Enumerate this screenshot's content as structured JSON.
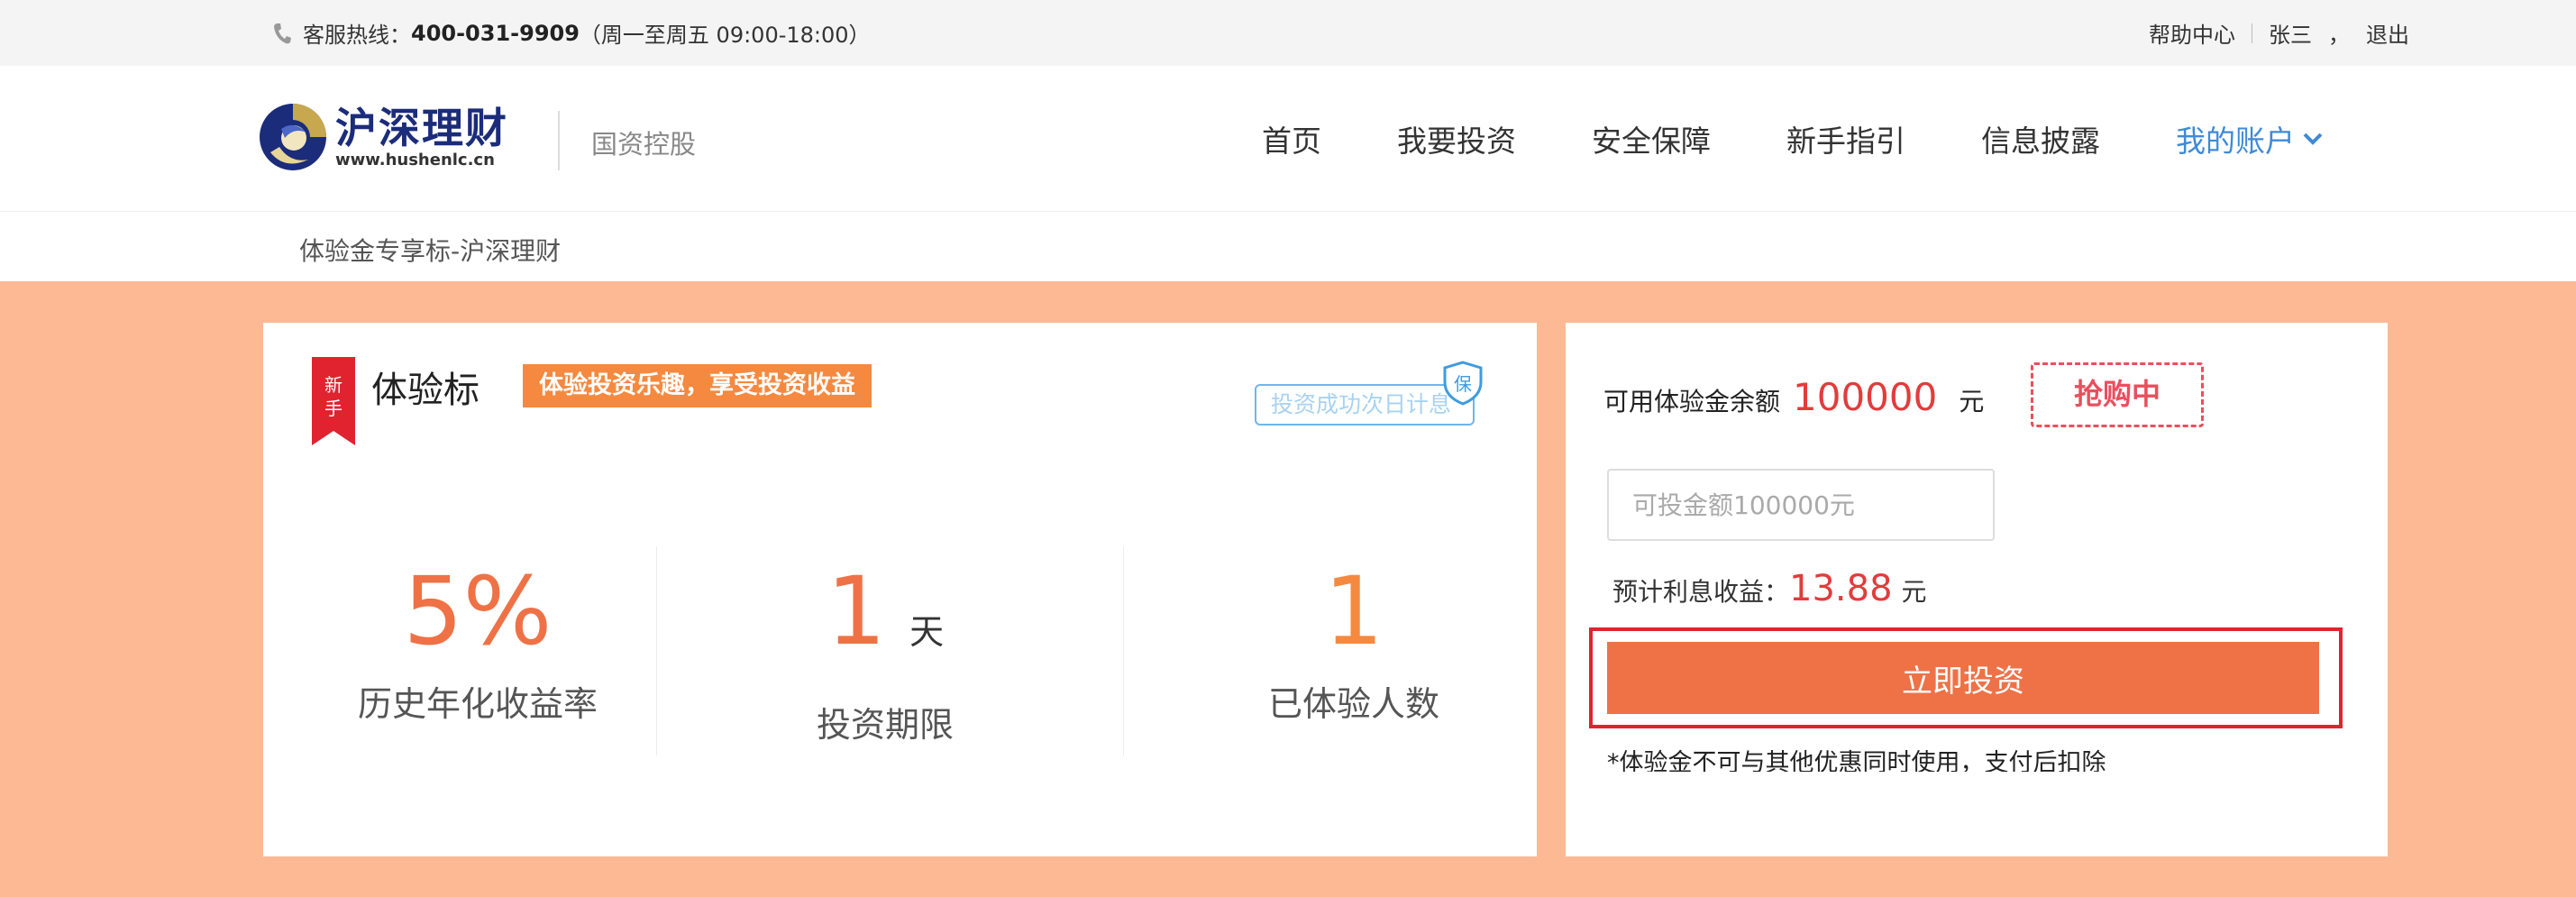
{
  "topbar": {
    "hotline_label": "客服热线：",
    "hotline_number": "400-031-9909",
    "hotline_hours": "（周一至周五 09:00-18:00）",
    "help": "帮助中心",
    "user": "张三",
    "comma": "，",
    "logout": "退出"
  },
  "header": {
    "brand_cn": "沪深理财",
    "brand_url": "www.hushenlc.cn",
    "tagline": "国资控股",
    "nav": [
      "首页",
      "我要投资",
      "安全保障",
      "新手指引",
      "信息披露"
    ],
    "account": "我的账户"
  },
  "breadcrumb": "体验金专享标-沪深理财",
  "product": {
    "ribbon": "新手",
    "title": "体验标",
    "slogan": "体验投资乐趣，享受投资收益",
    "guarantee_tag": "投资成功次日计息",
    "shield_char": "保",
    "rate": "5%",
    "rate_label": "历史年化收益率",
    "term": "1",
    "term_unit": "天",
    "term_label": "投资期限",
    "count": "1",
    "count_label": "已体验人数"
  },
  "invest": {
    "balance_label": "可用体验金余额",
    "balance": "100000",
    "balance_unit": "元",
    "status_stamp": "抢购中",
    "input_placeholder": "可投金额100000元",
    "expect_label": "预计利息收益：",
    "expect_amount": "13.88",
    "expect_unit": "元",
    "button": "立即投资",
    "note": "*体验金不可与其他优惠同时使用，支付后扣除"
  },
  "colors": {
    "accent_orange": "#ee7246",
    "page_bg": "#fdb994",
    "link_blue": "#3f8ad8",
    "highlight_red": "#e0232f"
  }
}
